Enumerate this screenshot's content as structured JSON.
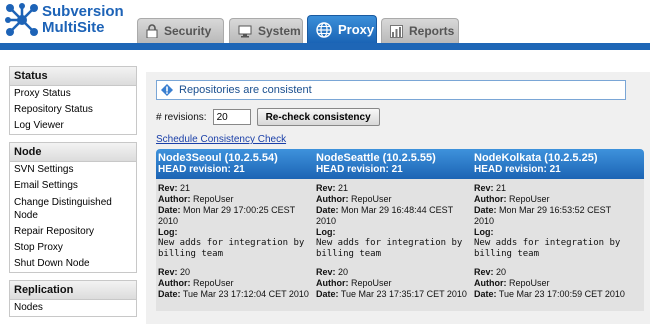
{
  "app": {
    "logo_line1": "Subversion",
    "logo_line2": "MultiSite"
  },
  "tabs": [
    {
      "label": "Security",
      "icon": "lock-icon"
    },
    {
      "label": "System",
      "icon": "monitor-icon"
    },
    {
      "label": "Proxy",
      "icon": "globe-icon",
      "active": true
    },
    {
      "label": "Reports",
      "icon": "chart-icon"
    }
  ],
  "sidebar": {
    "status": {
      "title": "Status",
      "items": [
        "Proxy Status",
        "Repository Status",
        "Log Viewer"
      ]
    },
    "node": {
      "title": "Node",
      "items": [
        "SVN Settings",
        "Email Settings",
        "Change Distinguished Node",
        "Repair Repository",
        "Stop Proxy",
        "Shut Down Node"
      ]
    },
    "replication": {
      "title": "Replication",
      "items": [
        "Nodes"
      ]
    }
  },
  "main": {
    "status_message": "Repositories are consistent",
    "revisions_label": "# revisions:",
    "revisions_value": "20",
    "recheck_label": "Re-check consistency",
    "schedule_link": "Schedule Consistency Check"
  },
  "nodes": [
    {
      "name": "Node3Seoul (10.2.5.54)",
      "head": "HEAD revision: 21",
      "revs": [
        {
          "rev": "21",
          "author": "RepoUser",
          "date": "Mon Mar 29 17:00:25 CEST 2010",
          "log": "New adds for integration by billing team"
        },
        {
          "rev": "20",
          "author": "RepoUser",
          "date": "Tue Mar 23 17:12:04 CET 2010"
        }
      ]
    },
    {
      "name": "NodeSeattle (10.2.5.55)",
      "head": "HEAD revision: 21",
      "revs": [
        {
          "rev": "21",
          "author": "RepoUser",
          "date": "Mon Mar 29 16:48:44 CEST 2010",
          "log": "New adds for integration by billing team"
        },
        {
          "rev": "20",
          "author": "RepoUser",
          "date": "Tue Mar 23 17:35:17 CET 2010"
        }
      ]
    },
    {
      "name": "NodeKolkata (10.2.5.25)",
      "head": "HEAD revision: 21",
      "revs": [
        {
          "rev": "21",
          "author": "RepoUser",
          "date": "Mon Mar 29 16:53:52 CEST 2010",
          "log": "New adds for integration by billing team"
        },
        {
          "rev": "20",
          "author": "RepoUser",
          "date": "Tue Mar 23 17:00:59 CET 2010"
        }
      ]
    }
  ],
  "labels": {
    "rev": "Rev:",
    "author": "Author:",
    "date": "Date:",
    "log": "Log:"
  },
  "colors": {
    "brand_blue": "#1e66b6",
    "link": "#1a3fa8"
  }
}
